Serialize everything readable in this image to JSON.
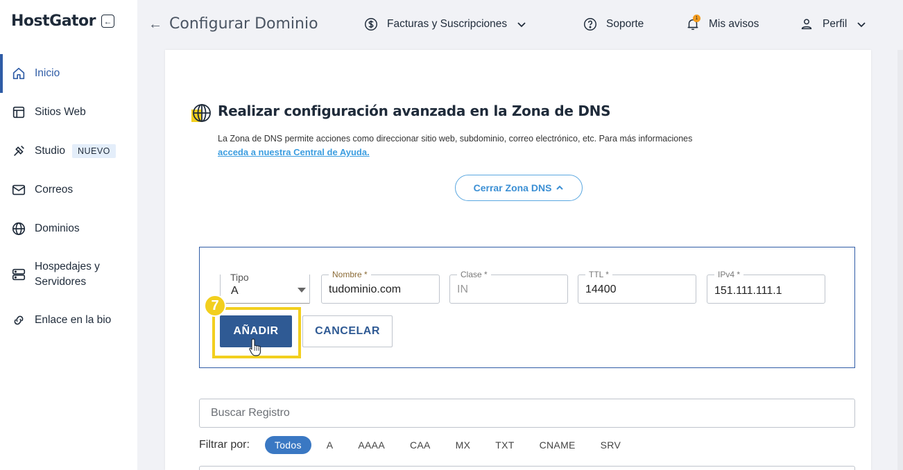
{
  "brand": {
    "name": "HostGator"
  },
  "sidebar": {
    "items": [
      {
        "label": "Inicio",
        "icon": "home-icon",
        "active": true
      },
      {
        "label": "Sitios Web",
        "icon": "layout-icon"
      },
      {
        "label": "Studio",
        "icon": "studio-icon",
        "badge": "NUEVO"
      },
      {
        "label": "Correos",
        "icon": "mail-icon"
      },
      {
        "label": "Dominios",
        "icon": "globe-icon"
      },
      {
        "label": "Hospedajes y Servidores",
        "icon": "server-icon"
      },
      {
        "label": "Enlace en la bio",
        "icon": "link-icon"
      }
    ]
  },
  "header": {
    "title": "Configurar Dominio",
    "billing": "Facturas y Suscripciones",
    "support": "Soporte",
    "notices": "Mis avisos",
    "notices_count": "1",
    "profile": "Perfil"
  },
  "dns": {
    "title": "Realizar configuración avanzada en la Zona de DNS",
    "description": "La Zona de DNS permite acciones como direccionar sitio web, subdominio, correo electrónico, etc. Para más informaciones",
    "help_link": "acceda a nuestra Central de Ayuda.",
    "close_button": "Cerrar Zona DNS"
  },
  "form": {
    "tipo_label": "Tipo",
    "tipo_value": "A",
    "nombre_label": "Nombre *",
    "nombre_value": "tudominio.com",
    "clase_label": "Clase *",
    "clase_value": "IN",
    "ttl_label": "TTL *",
    "ttl_value": "14400",
    "ipv4_label": "IPv4 *",
    "ipv4_value": "151.111.111.1",
    "add_button": "AÑADIR",
    "cancel_button": "CANCELAR",
    "step_number": "7"
  },
  "search": {
    "placeholder": "Buscar Registro"
  },
  "filters": {
    "label": "Filtrar por:",
    "options": [
      "Todos",
      "A",
      "AAAA",
      "CAA",
      "MX",
      "TXT",
      "CNAME",
      "SRV"
    ],
    "active": "Todos"
  },
  "colors": {
    "accent": "#2f5ca6",
    "highlight": "#f2cf1e",
    "link": "#3b9de0"
  }
}
